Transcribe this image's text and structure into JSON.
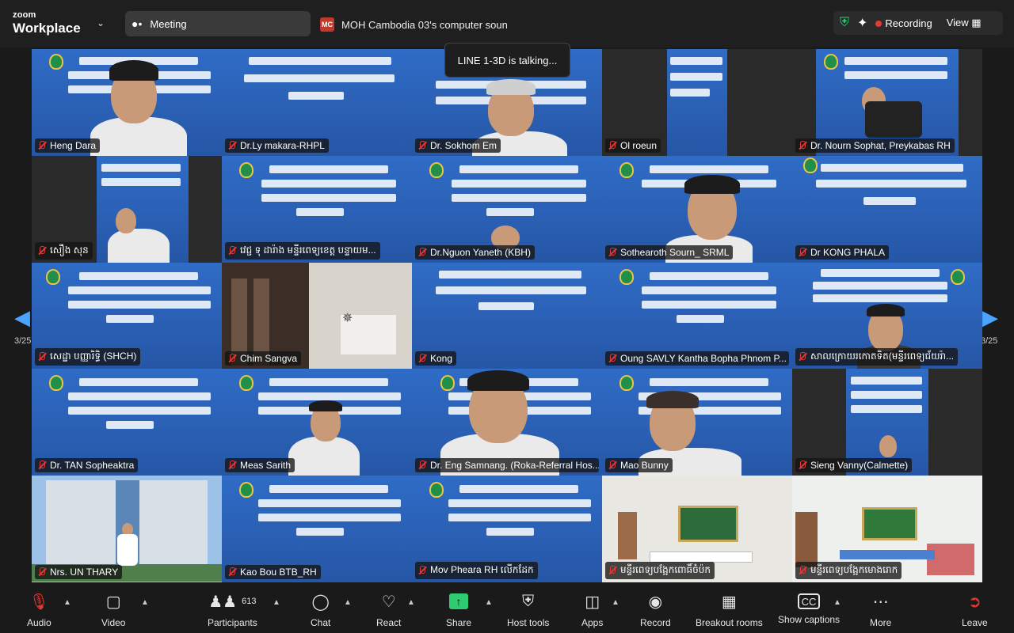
{
  "topbar": {
    "logo_line1": "zoom",
    "logo_line2": "Workplace",
    "meeting_label": "Meeting",
    "share_badge": "MC",
    "share_name": "MOH Cambodia 03's computer soun",
    "recording_label": "Recording",
    "view_label": "View"
  },
  "talking_indicator": "LINE 1-3D is talking...",
  "pagination": {
    "left": "3/25",
    "right": "3/25"
  },
  "tiles": [
    {
      "name": "Heng Dara"
    },
    {
      "name": "Dr.Ly makara-RHPL"
    },
    {
      "name": "Dr. Sokhom Em"
    },
    {
      "name": "Ol roeun"
    },
    {
      "name": "Dr. Nourn Sophat, Preykabas RH"
    },
    {
      "name": "សឿង សុន"
    },
    {
      "name": "វេជ្ជ ទុ ដារ៉ាង មន្ទីរពេទ្យខេត្ត បន្ទាយម..."
    },
    {
      "name": "Dr.Nguon Yaneth (KBH)"
    },
    {
      "name": "Sothearoth Sourn_ SRML"
    },
    {
      "name": "Dr KONG PHALA"
    },
    {
      "name": "សេដ្ឋា បញ្ញារិទ្ធិ (SHCH)"
    },
    {
      "name": "Chim Sangva"
    },
    {
      "name": "Kong"
    },
    {
      "name": "Oung SAVLY Kantha Bopha Phnom P..."
    },
    {
      "name": "សាលក្រោយរកោតទិត(មន្ទីរពេទ្យជ័យរ៉ា..."
    },
    {
      "name": "Dr. TAN Sopheaktra"
    },
    {
      "name": "Meas Sarith"
    },
    {
      "name": "Dr. Eng Samnang. (Roka-Referral Hos..."
    },
    {
      "name": "Mao Bunny"
    },
    {
      "name": "Sieng Vanny(Calmette)"
    },
    {
      "name": "Nrs. UN THARY"
    },
    {
      "name": "Kao Bou BTB_RH"
    },
    {
      "name": "Mov Pheara  RH លើកដែក"
    },
    {
      "name": "មន្ទីរពេទ្យបង្អែកពោធិ៍ចំប៉ក"
    },
    {
      "name": "មន្ទីរពេទ្យបង្អែកមោងរោក"
    }
  ],
  "toolbar": {
    "audio": "Audio",
    "video": "Video",
    "participants": "Participants",
    "participants_count": "613",
    "chat": "Chat",
    "react": "React",
    "share": "Share",
    "host_tools": "Host tools",
    "apps": "Apps",
    "record": "Record",
    "breakout": "Breakout rooms",
    "captions": "Show captions",
    "more": "More",
    "leave": "Leave"
  },
  "colors": {
    "slide_blue": "#2b5fb8",
    "recording_red": "#e53935",
    "share_green": "#2ecc71",
    "nav_blue": "#4aa3ff"
  }
}
